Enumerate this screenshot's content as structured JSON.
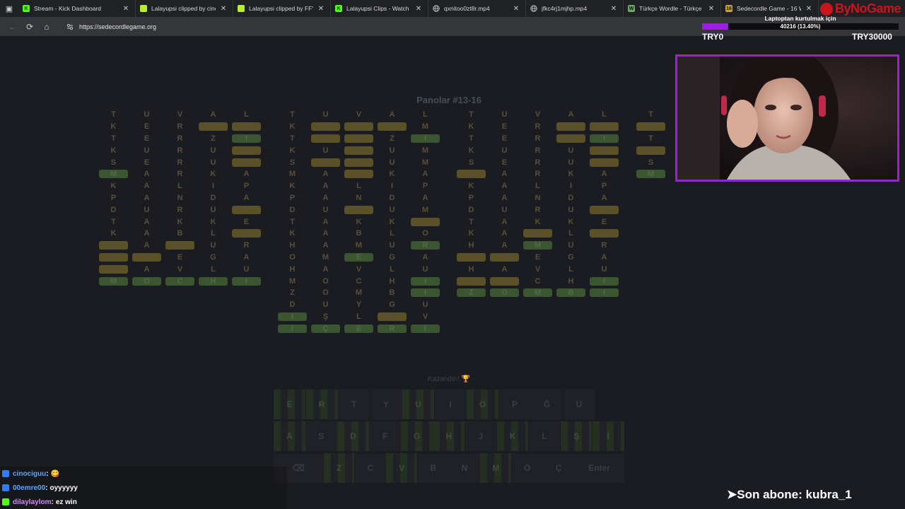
{
  "browser": {
    "tabs": [
      {
        "label": "Stream - Kick Dashboard",
        "favicon": "kick-icon",
        "fav_color": "#53fc18",
        "fav_text": "K",
        "width": 166
      },
      {
        "label": "Lalayupsi clipped by cinoc…",
        "favicon": "kick-icon",
        "fav_color": "#b7ef2a",
        "fav_text": "",
        "width": 138
      },
      {
        "label": "Lalayupsi clipped by FFYou…",
        "favicon": "kick-icon",
        "fav_color": "#b7ef2a",
        "fav_text": "",
        "width": 138
      },
      {
        "label": "Lalayupsi Clips - Watch Live…",
        "favicon": "kick-icon",
        "fav_color": "#53fc18",
        "fav_text": "K",
        "width": 138
      },
      {
        "label": "qxnitoo0zt8r.mp4",
        "favicon": "globe-icon",
        "fav_color": "",
        "fav_text": "",
        "width": 138
      },
      {
        "label": "jfkc4rj1mjhp.mp4",
        "favicon": "globe-icon",
        "fav_color": "",
        "fav_text": "",
        "width": 138
      },
      {
        "label": "Türkçe Wordle - Türkçe Keli…",
        "favicon": "wordle-icon",
        "fav_color": "#6aaa64",
        "fav_text": "W",
        "width": 138
      },
      {
        "label": "Sedecordle Game - 16 Wor…",
        "favicon": "sedecordle-icon",
        "fav_color": "#c9a23a",
        "fav_text": "16",
        "width": 138
      }
    ],
    "url": "https://sedecordlegame.org"
  },
  "game": {
    "title": "Panolar #13-16",
    "status": "Kazandın! 🏆",
    "boards": [
      {
        "rows": [
          [
            "T",
            "U",
            "V",
            "A",
            "L"
          ],
          [
            "K",
            "E",
            "R",
            "I",
            "M"
          ],
          [
            "T",
            "E",
            "R",
            "Z",
            "I"
          ],
          [
            "K",
            "U",
            "R",
            "U",
            "M"
          ],
          [
            "S",
            "E",
            "R",
            "U",
            "M"
          ],
          [
            "M",
            "A",
            "R",
            "K",
            "A"
          ],
          [
            "K",
            "A",
            "L",
            "I",
            "P"
          ],
          [
            "P",
            "A",
            "N",
            "D",
            "A"
          ],
          [
            "D",
            "U",
            "R",
            "U",
            "M"
          ],
          [
            "T",
            "A",
            "K",
            "K",
            "E"
          ],
          [
            "K",
            "A",
            "B",
            "L",
            "O"
          ],
          [
            "H",
            "A",
            "M",
            "U",
            "R"
          ],
          [
            "O",
            "M",
            "E",
            "G",
            "A"
          ],
          [
            "H",
            "A",
            "V",
            "L",
            "U"
          ],
          [
            "M",
            "O",
            "C",
            "H",
            "I"
          ]
        ],
        "marks": [
          "-----",
          "---yy",
          "----g",
          "----y",
          "----y",
          "g----",
          "-----",
          "-----",
          "----y",
          "-----",
          "----y",
          "y-y--",
          "yy---",
          "y----",
          "ggggg"
        ]
      },
      {
        "rows": [
          [
            "T",
            "U",
            "V",
            "A",
            "L"
          ],
          [
            "K",
            "E",
            "R",
            "I",
            "M"
          ],
          [
            "T",
            "E",
            "R",
            "Z",
            "I"
          ],
          [
            "K",
            "U",
            "R",
            "U",
            "M"
          ],
          [
            "S",
            "E",
            "R",
            "U",
            "M"
          ],
          [
            "M",
            "A",
            "R",
            "K",
            "A"
          ],
          [
            "K",
            "A",
            "L",
            "I",
            "P"
          ],
          [
            "P",
            "A",
            "N",
            "D",
            "A"
          ],
          [
            "D",
            "U",
            "R",
            "U",
            "M"
          ],
          [
            "T",
            "A",
            "K",
            "K",
            "E"
          ],
          [
            "K",
            "A",
            "B",
            "L",
            "O"
          ],
          [
            "H",
            "A",
            "M",
            "U",
            "R"
          ],
          [
            "O",
            "M",
            "E",
            "G",
            "A"
          ],
          [
            "H",
            "A",
            "V",
            "L",
            "U"
          ],
          [
            "M",
            "O",
            "C",
            "H",
            "I"
          ],
          [
            "Z",
            "O",
            "M",
            "B",
            "I"
          ],
          [
            "D",
            "U",
            "Y",
            "G",
            "U"
          ],
          [
            "I",
            "Ş",
            "L",
            "E",
            "V"
          ],
          [
            "I",
            "Ç",
            "E",
            "R",
            "I"
          ]
        ],
        "marks": [
          "-----",
          "-yyy-",
          "-yy-g",
          "--y--",
          "-yy--",
          "--y--",
          "-----",
          "-----",
          "--y--",
          "----y",
          "-----",
          "----g",
          "--g--",
          "-----",
          "----g",
          "----g",
          "-----",
          "g--y-",
          "ggggg"
        ]
      },
      {
        "rows": [
          [
            "T",
            "U",
            "V",
            "A",
            "L"
          ],
          [
            "K",
            "E",
            "R",
            "I",
            "M"
          ],
          [
            "T",
            "E",
            "R",
            "Z",
            "I"
          ],
          [
            "K",
            "U",
            "R",
            "U",
            "M"
          ],
          [
            "S",
            "E",
            "R",
            "U",
            "M"
          ],
          [
            "M",
            "A",
            "R",
            "K",
            "A"
          ],
          [
            "K",
            "A",
            "L",
            "I",
            "P"
          ],
          [
            "P",
            "A",
            "N",
            "D",
            "A"
          ],
          [
            "D",
            "U",
            "R",
            "U",
            "M"
          ],
          [
            "T",
            "A",
            "K",
            "K",
            "E"
          ],
          [
            "K",
            "A",
            "B",
            "L",
            "O"
          ],
          [
            "H",
            "A",
            "M",
            "U",
            "R"
          ],
          [
            "O",
            "M",
            "E",
            "G",
            "A"
          ],
          [
            "H",
            "A",
            "V",
            "L",
            "U"
          ],
          [
            "M",
            "O",
            "C",
            "H",
            "I"
          ],
          [
            "Z",
            "O",
            "M",
            "B",
            "I"
          ]
        ],
        "marks": [
          "-----",
          "---yy",
          "---yg",
          "----y",
          "----y",
          "y----",
          "-----",
          "-----",
          "----y",
          "-----",
          "--y-y",
          "--g--",
          "yy---",
          "-----",
          "yy--g",
          "ggggg"
        ]
      },
      {
        "rows": [
          [
            "T",
            "U",
            "V",
            "A",
            "L"
          ],
          [
            "K",
            "E",
            "R",
            "I",
            "M"
          ],
          [
            "T",
            "E",
            "R",
            "Z",
            "I"
          ],
          [
            "K",
            "U",
            "R",
            "U",
            "M"
          ],
          [
            "S",
            "E",
            "R",
            "U",
            "M"
          ],
          [
            "M",
            "A",
            "R",
            "K",
            "A"
          ]
        ],
        "marks": [
          "-----",
          "y----",
          "-----",
          "y----",
          "-----",
          "g----"
        ]
      }
    ],
    "keyboard": [
      [
        "E",
        "R",
        "T",
        "Y",
        "U",
        "I",
        "O",
        "P",
        "Ğ",
        "Ü"
      ],
      [
        "A",
        "S",
        "D",
        "F",
        "G",
        "H",
        "J",
        "K",
        "L",
        "Ş",
        "İ"
      ],
      [
        "⌫",
        "Z",
        "C",
        "V",
        "B",
        "N",
        "M",
        "Ö",
        "Ç",
        "Enter"
      ]
    ],
    "keyboard_green": [
      "E",
      "R",
      "U",
      "O",
      "A",
      "D",
      "G",
      "H",
      "K",
      "Ş",
      "İ",
      "Z",
      "V",
      "M"
    ]
  },
  "overlay": {
    "brand": "ByNoGame",
    "goal_title": "Laptoptan kurtulmak için",
    "goal_value": "40216 (13.40%)",
    "goal_progress": 0.134,
    "goal_min": "TRY0",
    "goal_max": "TRY30000",
    "accent": "#9d1fd6",
    "last_sub": "➤Son abone: kubra_1",
    "chat": [
      {
        "user": "cinociguu",
        "user_color": "#5aa6ff",
        "message": "😋",
        "badge_color": "#2f7cf6"
      },
      {
        "user": "00emre00",
        "user_color": "#5aa6ff",
        "message": "oyyyyyy",
        "badge_color": "#2f7cf6"
      },
      {
        "user": "dilaylaylom",
        "user_color": "#d18cf7",
        "message": "ez win",
        "badge_color": "#53fc18"
      }
    ]
  }
}
